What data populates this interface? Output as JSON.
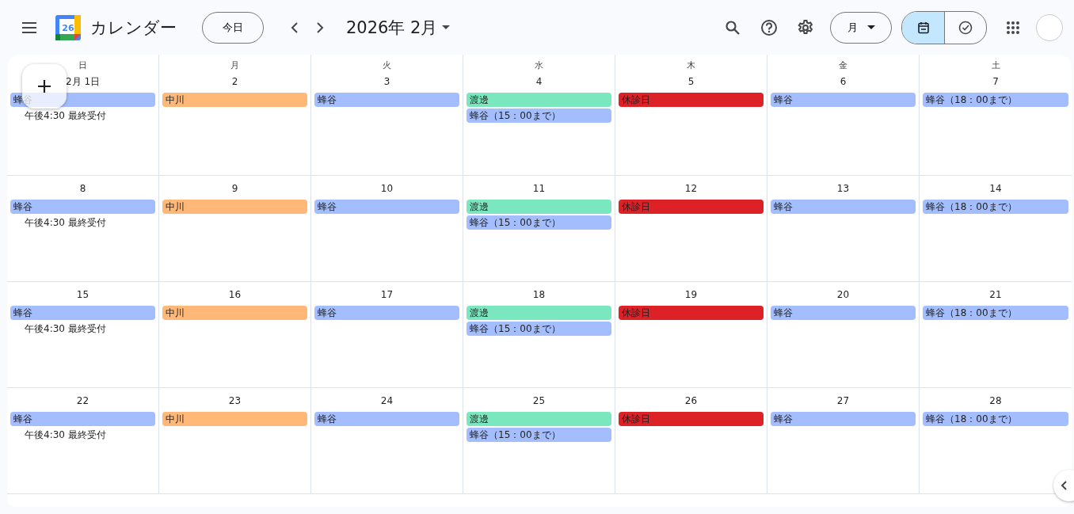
{
  "header": {
    "app_name": "カレンダー",
    "logo_day": "26",
    "today_button": "今日",
    "period": "2026年 2月",
    "view_select": "月",
    "view_toggle": [
      {
        "kind": "calendar",
        "selected": true
      },
      {
        "kind": "tasks",
        "selected": false
      }
    ]
  },
  "weekdays": [
    "日",
    "月",
    "火",
    "水",
    "木",
    "金",
    "土"
  ],
  "weeks": [
    {
      "days": [
        {
          "date": "2月 1日",
          "events": [
            {
              "kind": "chip",
              "title": "蜂谷",
              "color": "#a4bdfc"
            },
            {
              "kind": "text",
              "title": "午後4:30 最終受付"
            }
          ]
        },
        {
          "date": "2",
          "events": [
            {
              "kind": "chip",
              "title": "中川",
              "color": "#ffb878"
            }
          ]
        },
        {
          "date": "3",
          "events": [
            {
              "kind": "chip",
              "title": "蜂谷",
              "color": "#a4bdfc"
            }
          ]
        },
        {
          "date": "4",
          "events": [
            {
              "kind": "chip",
              "title": "渡邊",
              "color": "#7ae7bf"
            },
            {
              "kind": "chip",
              "title": "蜂谷（15：00まで）",
              "color": "#a4bdfc"
            }
          ]
        },
        {
          "date": "5",
          "events": [
            {
              "kind": "chip",
              "title": "休診日",
              "color": "#dc2127"
            }
          ]
        },
        {
          "date": "6",
          "events": [
            {
              "kind": "chip",
              "title": "蜂谷",
              "color": "#a4bdfc"
            }
          ]
        },
        {
          "date": "7",
          "events": [
            {
              "kind": "chip",
              "title": "蜂谷（18：00まで）",
              "color": "#a4bdfc"
            }
          ]
        }
      ]
    },
    {
      "days": [
        {
          "date": "8",
          "events": [
            {
              "kind": "chip",
              "title": "蜂谷",
              "color": "#a4bdfc"
            },
            {
              "kind": "text",
              "title": "午後4:30 最終受付"
            }
          ]
        },
        {
          "date": "9",
          "events": [
            {
              "kind": "chip",
              "title": "中川",
              "color": "#ffb878"
            }
          ]
        },
        {
          "date": "10",
          "events": [
            {
              "kind": "chip",
              "title": "蜂谷",
              "color": "#a4bdfc"
            }
          ]
        },
        {
          "date": "11",
          "events": [
            {
              "kind": "chip",
              "title": "渡邊",
              "color": "#7ae7bf"
            },
            {
              "kind": "chip",
              "title": "蜂谷（15：00まで）",
              "color": "#a4bdfc"
            }
          ]
        },
        {
          "date": "12",
          "events": [
            {
              "kind": "chip",
              "title": "休診日",
              "color": "#dc2127"
            }
          ]
        },
        {
          "date": "13",
          "events": [
            {
              "kind": "chip",
              "title": "蜂谷",
              "color": "#a4bdfc"
            }
          ]
        },
        {
          "date": "14",
          "events": [
            {
              "kind": "chip",
              "title": "蜂谷（18：00まで）",
              "color": "#a4bdfc"
            }
          ]
        }
      ]
    },
    {
      "days": [
        {
          "date": "15",
          "events": [
            {
              "kind": "chip",
              "title": "蜂谷",
              "color": "#a4bdfc"
            },
            {
              "kind": "text",
              "title": "午後4:30 最終受付"
            }
          ]
        },
        {
          "date": "16",
          "events": [
            {
              "kind": "chip",
              "title": "中川",
              "color": "#ffb878"
            }
          ]
        },
        {
          "date": "17",
          "events": [
            {
              "kind": "chip",
              "title": "蜂谷",
              "color": "#a4bdfc"
            }
          ]
        },
        {
          "date": "18",
          "events": [
            {
              "kind": "chip",
              "title": "渡邊",
              "color": "#7ae7bf"
            },
            {
              "kind": "chip",
              "title": "蜂谷（15：00まで）",
              "color": "#a4bdfc"
            }
          ]
        },
        {
          "date": "19",
          "events": [
            {
              "kind": "chip",
              "title": "休診日",
              "color": "#dc2127"
            }
          ]
        },
        {
          "date": "20",
          "events": [
            {
              "kind": "chip",
              "title": "蜂谷",
              "color": "#a4bdfc"
            }
          ]
        },
        {
          "date": "21",
          "events": [
            {
              "kind": "chip",
              "title": "蜂谷（18：00まで）",
              "color": "#a4bdfc"
            }
          ]
        }
      ]
    },
    {
      "days": [
        {
          "date": "22",
          "events": [
            {
              "kind": "chip",
              "title": "蜂谷",
              "color": "#a4bdfc"
            },
            {
              "kind": "text",
              "title": "午後4:30 最終受付"
            }
          ]
        },
        {
          "date": "23",
          "events": [
            {
              "kind": "chip",
              "title": "中川",
              "color": "#ffb878"
            }
          ]
        },
        {
          "date": "24",
          "events": [
            {
              "kind": "chip",
              "title": "蜂谷",
              "color": "#a4bdfc"
            }
          ]
        },
        {
          "date": "25",
          "events": [
            {
              "kind": "chip",
              "title": "渡邊",
              "color": "#7ae7bf"
            },
            {
              "kind": "chip",
              "title": "蜂谷（15：00まで）",
              "color": "#a4bdfc"
            }
          ]
        },
        {
          "date": "26",
          "events": [
            {
              "kind": "chip",
              "title": "休診日",
              "color": "#dc2127"
            }
          ]
        },
        {
          "date": "27",
          "events": [
            {
              "kind": "chip",
              "title": "蜂谷",
              "color": "#a4bdfc"
            }
          ]
        },
        {
          "date": "28",
          "events": [
            {
              "kind": "chip",
              "title": "蜂谷（18：00まで）",
              "color": "#a4bdfc"
            }
          ]
        }
      ]
    }
  ]
}
